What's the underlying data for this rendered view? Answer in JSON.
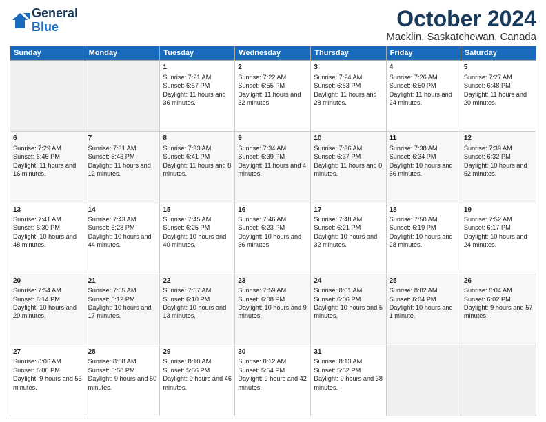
{
  "header": {
    "logo_line1": "General",
    "logo_line2": "Blue",
    "month": "October 2024",
    "location": "Macklin, Saskatchewan, Canada"
  },
  "weekdays": [
    "Sunday",
    "Monday",
    "Tuesday",
    "Wednesday",
    "Thursday",
    "Friday",
    "Saturday"
  ],
  "weeks": [
    [
      {
        "day": "",
        "content": ""
      },
      {
        "day": "",
        "content": ""
      },
      {
        "day": "1",
        "content": "Sunrise: 7:21 AM\nSunset: 6:57 PM\nDaylight: 11 hours and 36 minutes."
      },
      {
        "day": "2",
        "content": "Sunrise: 7:22 AM\nSunset: 6:55 PM\nDaylight: 11 hours and 32 minutes."
      },
      {
        "day": "3",
        "content": "Sunrise: 7:24 AM\nSunset: 6:53 PM\nDaylight: 11 hours and 28 minutes."
      },
      {
        "day": "4",
        "content": "Sunrise: 7:26 AM\nSunset: 6:50 PM\nDaylight: 11 hours and 24 minutes."
      },
      {
        "day": "5",
        "content": "Sunrise: 7:27 AM\nSunset: 6:48 PM\nDaylight: 11 hours and 20 minutes."
      }
    ],
    [
      {
        "day": "6",
        "content": "Sunrise: 7:29 AM\nSunset: 6:46 PM\nDaylight: 11 hours and 16 minutes."
      },
      {
        "day": "7",
        "content": "Sunrise: 7:31 AM\nSunset: 6:43 PM\nDaylight: 11 hours and 12 minutes."
      },
      {
        "day": "8",
        "content": "Sunrise: 7:33 AM\nSunset: 6:41 PM\nDaylight: 11 hours and 8 minutes."
      },
      {
        "day": "9",
        "content": "Sunrise: 7:34 AM\nSunset: 6:39 PM\nDaylight: 11 hours and 4 minutes."
      },
      {
        "day": "10",
        "content": "Sunrise: 7:36 AM\nSunset: 6:37 PM\nDaylight: 11 hours and 0 minutes."
      },
      {
        "day": "11",
        "content": "Sunrise: 7:38 AM\nSunset: 6:34 PM\nDaylight: 10 hours and 56 minutes."
      },
      {
        "day": "12",
        "content": "Sunrise: 7:39 AM\nSunset: 6:32 PM\nDaylight: 10 hours and 52 minutes."
      }
    ],
    [
      {
        "day": "13",
        "content": "Sunrise: 7:41 AM\nSunset: 6:30 PM\nDaylight: 10 hours and 48 minutes."
      },
      {
        "day": "14",
        "content": "Sunrise: 7:43 AM\nSunset: 6:28 PM\nDaylight: 10 hours and 44 minutes."
      },
      {
        "day": "15",
        "content": "Sunrise: 7:45 AM\nSunset: 6:25 PM\nDaylight: 10 hours and 40 minutes."
      },
      {
        "day": "16",
        "content": "Sunrise: 7:46 AM\nSunset: 6:23 PM\nDaylight: 10 hours and 36 minutes."
      },
      {
        "day": "17",
        "content": "Sunrise: 7:48 AM\nSunset: 6:21 PM\nDaylight: 10 hours and 32 minutes."
      },
      {
        "day": "18",
        "content": "Sunrise: 7:50 AM\nSunset: 6:19 PM\nDaylight: 10 hours and 28 minutes."
      },
      {
        "day": "19",
        "content": "Sunrise: 7:52 AM\nSunset: 6:17 PM\nDaylight: 10 hours and 24 minutes."
      }
    ],
    [
      {
        "day": "20",
        "content": "Sunrise: 7:54 AM\nSunset: 6:14 PM\nDaylight: 10 hours and 20 minutes."
      },
      {
        "day": "21",
        "content": "Sunrise: 7:55 AM\nSunset: 6:12 PM\nDaylight: 10 hours and 17 minutes."
      },
      {
        "day": "22",
        "content": "Sunrise: 7:57 AM\nSunset: 6:10 PM\nDaylight: 10 hours and 13 minutes."
      },
      {
        "day": "23",
        "content": "Sunrise: 7:59 AM\nSunset: 6:08 PM\nDaylight: 10 hours and 9 minutes."
      },
      {
        "day": "24",
        "content": "Sunrise: 8:01 AM\nSunset: 6:06 PM\nDaylight: 10 hours and 5 minutes."
      },
      {
        "day": "25",
        "content": "Sunrise: 8:02 AM\nSunset: 6:04 PM\nDaylight: 10 hours and 1 minute."
      },
      {
        "day": "26",
        "content": "Sunrise: 8:04 AM\nSunset: 6:02 PM\nDaylight: 9 hours and 57 minutes."
      }
    ],
    [
      {
        "day": "27",
        "content": "Sunrise: 8:06 AM\nSunset: 6:00 PM\nDaylight: 9 hours and 53 minutes."
      },
      {
        "day": "28",
        "content": "Sunrise: 8:08 AM\nSunset: 5:58 PM\nDaylight: 9 hours and 50 minutes."
      },
      {
        "day": "29",
        "content": "Sunrise: 8:10 AM\nSunset: 5:56 PM\nDaylight: 9 hours and 46 minutes."
      },
      {
        "day": "30",
        "content": "Sunrise: 8:12 AM\nSunset: 5:54 PM\nDaylight: 9 hours and 42 minutes."
      },
      {
        "day": "31",
        "content": "Sunrise: 8:13 AM\nSunset: 5:52 PM\nDaylight: 9 hours and 38 minutes."
      },
      {
        "day": "",
        "content": ""
      },
      {
        "day": "",
        "content": ""
      }
    ]
  ]
}
